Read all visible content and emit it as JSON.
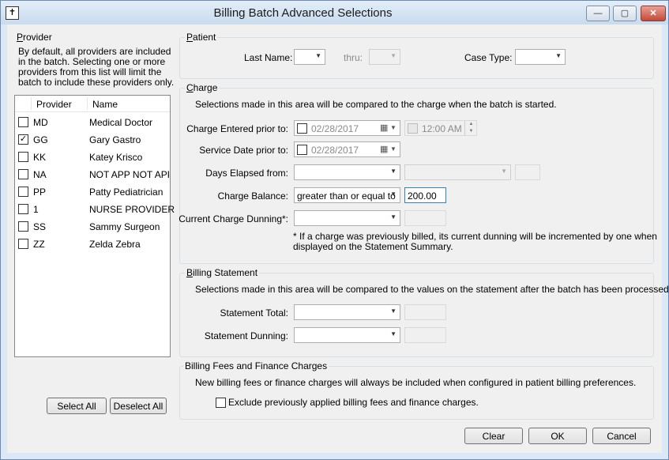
{
  "window": {
    "title": "Billing Batch Advanced Selections",
    "app_icon": "✝",
    "minimize": "—",
    "maximize": "▢",
    "close": "✕"
  },
  "provider": {
    "group_label": "Provider",
    "description_lines": [
      "By default, all providers are included",
      "in the batch. Selecting one or more",
      "providers from this list will limit the",
      "batch to include these providers only."
    ],
    "columns": [
      "Provider",
      "Name"
    ],
    "rows": [
      {
        "code": "MD",
        "name": "Medical  Doctor",
        "checked": false,
        "check_mark": ""
      },
      {
        "code": "GG",
        "name": "Gary  Gastro",
        "checked": true,
        "check_mark": "✓"
      },
      {
        "code": "KK",
        "name": "Katey Krisco",
        "checked": false,
        "check_mark": ""
      },
      {
        "code": "NA",
        "name": "NOT APP NOT APPL",
        "checked": false,
        "check_mark": ""
      },
      {
        "code": "PP",
        "name": "Patty Pediatrician",
        "checked": false,
        "check_mark": ""
      },
      {
        "code": "1",
        "name": "NURSE PROVIDER",
        "checked": false,
        "check_mark": ""
      },
      {
        "code": "SS",
        "name": "Sammy Surgeon",
        "checked": false,
        "check_mark": ""
      },
      {
        "code": "ZZ",
        "name": "Zelda Zebra",
        "checked": false,
        "check_mark": ""
      }
    ],
    "select_all": "Select All",
    "deselect_all": "Deselect All"
  },
  "patient": {
    "group_label": "Patient",
    "last_name_label": "Last Name:",
    "last_name_value": "",
    "thru_label": "thru:",
    "thru_value": "",
    "case_type_label": "Case Type:",
    "case_type_value": ""
  },
  "charge": {
    "group_label": "Charge",
    "description": "Selections made in this area will be compared to the charge when the batch is started.",
    "entered_prior_label": "Charge Entered prior to:",
    "entered_prior_date": "02/28/2017",
    "entered_prior_time": "12:00 AM",
    "service_date_label": "Service Date prior to:",
    "service_date": "02/28/2017",
    "days_elapsed_label": "Days Elapsed from:",
    "days_elapsed_value": "",
    "days_elapsed_op": "",
    "days_elapsed_num": "",
    "balance_label": "Charge Balance:",
    "balance_operator": "greater than or equal to",
    "balance_value": "200.00",
    "dunning_label": "Current Charge Dunning*:",
    "dunning_value": "",
    "dunning_num": "",
    "footnote_lines": [
      "* If a charge was previously billed, its current dunning will be incremented by one when",
      "displayed on the Statement Summary."
    ]
  },
  "billing_statement": {
    "group_label": "Billing Statement",
    "description": "Selections made in this area will be compared to the values on the statement after the batch has been processed.",
    "total_label": "Statement Total:",
    "total_value": "",
    "total_num": "",
    "dunning_label": "Statement Dunning:",
    "dunning_value": "",
    "dunning_num": ""
  },
  "fees": {
    "group_label": "Billing Fees and Finance Charges",
    "description": "New billing fees or finance charges will always be included when configured in patient billing preferences.",
    "exclude_label": "Exclude previously applied billing fees and finance charges.",
    "exclude_checked": false
  },
  "buttons": {
    "clear": "Clear",
    "ok": "OK",
    "cancel": "Cancel"
  },
  "icons": {
    "dropdown": "▼",
    "calendar": "▦",
    "spin_up": "▲",
    "spin_down": "▼"
  }
}
